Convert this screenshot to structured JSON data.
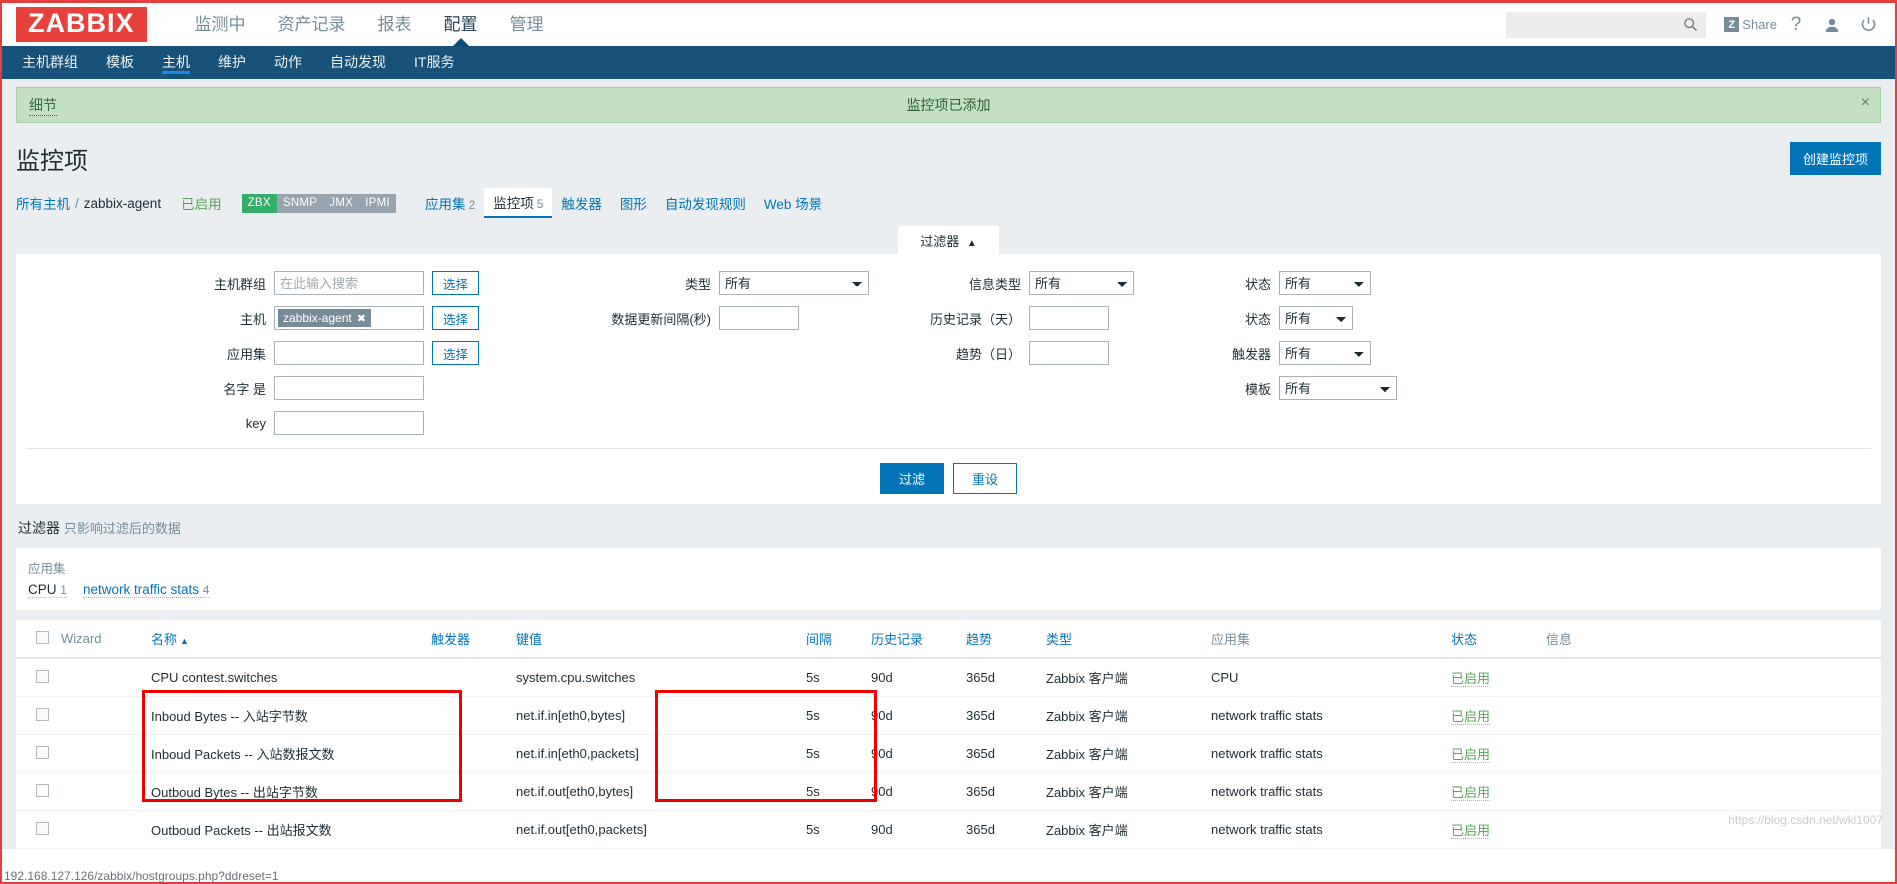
{
  "brand": {
    "logo": "ZABBIX"
  },
  "topnav": {
    "items": [
      {
        "label": "监测中",
        "active": false
      },
      {
        "label": "资产记录",
        "active": false
      },
      {
        "label": "报表",
        "active": false
      },
      {
        "label": "配置",
        "active": true
      },
      {
        "label": "管理",
        "active": false
      }
    ]
  },
  "search": {
    "value": "",
    "placeholder": "",
    "icon": "search-icon"
  },
  "header_actions": {
    "share_label": "Share",
    "share_badge": "Z",
    "help_icon": "question-mark-icon",
    "user_icon": "user-icon",
    "power_icon": "power-icon"
  },
  "subnav": {
    "items": [
      {
        "label": "主机群组",
        "active": false
      },
      {
        "label": "模板",
        "active": false
      },
      {
        "label": "主机",
        "active": true
      },
      {
        "label": "维护",
        "active": false
      },
      {
        "label": "动作",
        "active": false
      },
      {
        "label": "自动发现",
        "active": false
      },
      {
        "label": "IT服务",
        "active": false
      }
    ]
  },
  "message": {
    "details_label": "细节",
    "text": "监控项已添加",
    "close_icon": "close-icon"
  },
  "page": {
    "title": "监控项",
    "create_button": "创建监控项"
  },
  "breadcrumb": {
    "all_hosts": "所有主机",
    "separator": "/",
    "host": "zabbix-agent",
    "status": "已启用",
    "protocols": [
      {
        "label": "ZBX",
        "enabled": true
      },
      {
        "label": "SNMP",
        "enabled": false
      },
      {
        "label": "JMX",
        "enabled": false
      },
      {
        "label": "IPMI",
        "enabled": false
      }
    ],
    "tabs": [
      {
        "label": "应用集",
        "count": "2",
        "selected": false
      },
      {
        "label": "监控项",
        "count": "5",
        "selected": true
      },
      {
        "label": "触发器",
        "count": "",
        "selected": false
      },
      {
        "label": "图形",
        "count": "",
        "selected": false
      },
      {
        "label": "自动发现规则",
        "count": "",
        "selected": false
      },
      {
        "label": "Web 场景",
        "count": "",
        "selected": false
      }
    ]
  },
  "filter": {
    "tab_label": "过滤器",
    "tab_caret": "▲",
    "col1": [
      {
        "label": "主机群组",
        "type": "text",
        "value": "",
        "placeholder": "在此输入搜索",
        "button": "选择"
      },
      {
        "label": "主机",
        "type": "chip",
        "chip": "zabbix-agent",
        "button": "选择"
      },
      {
        "label": "应用集",
        "type": "text",
        "value": "",
        "placeholder": "",
        "button": "选择"
      },
      {
        "label": "名字 是",
        "type": "text",
        "value": "",
        "placeholder": ""
      },
      {
        "label": "key",
        "type": "text",
        "value": "",
        "placeholder": ""
      }
    ],
    "col2": [
      {
        "label": "类型",
        "type": "select",
        "value": "所有"
      },
      {
        "label": "数据更新间隔(秒)",
        "type": "text",
        "value": ""
      }
    ],
    "col3": [
      {
        "label": "信息类型",
        "type": "select",
        "value": "所有"
      },
      {
        "label": "历史记录（天）",
        "type": "text",
        "value": ""
      },
      {
        "label": "趋势（日）",
        "type": "text",
        "value": ""
      }
    ],
    "col4": [
      {
        "label": "状态",
        "type": "select",
        "value": "所有"
      },
      {
        "label": "状态",
        "type": "select",
        "value": "所有"
      },
      {
        "label": "触发器",
        "type": "select",
        "value": "所有"
      },
      {
        "label": "模板",
        "type": "select",
        "value": "所有"
      }
    ],
    "apply_button": "过滤",
    "reset_button": "重设"
  },
  "filter_note": {
    "bold": "过滤器",
    "rest": "只影响过滤后的数据"
  },
  "appset": {
    "title": "应用集",
    "links": [
      {
        "label": "CPU",
        "count": "1",
        "selected": false
      },
      {
        "label": "network traffic stats",
        "count": "4",
        "selected": false
      }
    ]
  },
  "table": {
    "headers": [
      {
        "label": "",
        "type": "checkbox"
      },
      {
        "label": "Wizard",
        "link": false
      },
      {
        "label": "名称",
        "link": true,
        "sort": "▲"
      },
      {
        "label": "触发器",
        "link": true
      },
      {
        "label": "键值",
        "link": true
      },
      {
        "label": "间隔",
        "link": true
      },
      {
        "label": "历史记录",
        "link": true
      },
      {
        "label": "趋势",
        "link": true
      },
      {
        "label": "类型",
        "link": true
      },
      {
        "label": "应用集",
        "link": false
      },
      {
        "label": "状态",
        "link": true
      },
      {
        "label": "信息",
        "link": false
      }
    ],
    "rows": [
      {
        "name": "CPU contest.switches",
        "triggers": "",
        "key": "system.cpu.switches",
        "interval": "5s",
        "history": "90d",
        "trends": "365d",
        "type": "Zabbix 客户端",
        "appset": "CPU",
        "status": "已启用",
        "info": ""
      },
      {
        "name": "Inboud Bytes -- 入站字节数",
        "triggers": "",
        "key": "net.if.in[eth0,bytes]",
        "interval": "5s",
        "history": "90d",
        "trends": "365d",
        "type": "Zabbix 客户端",
        "appset": "network traffic stats",
        "status": "已启用",
        "info": ""
      },
      {
        "name": "Inboud Packets -- 入站数报文数",
        "triggers": "",
        "key": "net.if.in[eth0,packets]",
        "interval": "5s",
        "history": "90d",
        "trends": "365d",
        "type": "Zabbix 客户端",
        "appset": "network traffic stats",
        "status": "已启用",
        "info": ""
      },
      {
        "name": "Outboud Bytes -- 出站字节数",
        "triggers": "",
        "key": "net.if.out[eth0,bytes]",
        "interval": "5s",
        "history": "90d",
        "trends": "365d",
        "type": "Zabbix 客户端",
        "appset": "network traffic stats",
        "status": "已启用",
        "info": ""
      },
      {
        "name": "Outboud Packets -- 出站报文数",
        "triggers": "",
        "key": "net.if.out[eth0,packets]",
        "interval": "5s",
        "history": "90d",
        "trends": "365d",
        "type": "Zabbix 客户端",
        "appset": "network traffic stats",
        "status": "已启用",
        "info": ""
      }
    ]
  },
  "watermark": "https://blog.csdn.net/wkl1007",
  "footer_url": "192.168.127.126/zabbix/hostgroups.php?ddreset=1",
  "colors": {
    "brand_red": "#e8403a",
    "accent_blue": "#0275b8",
    "subnav_blue": "#17527a",
    "success_green": "#59a659",
    "annotation_red": "#f20000"
  }
}
